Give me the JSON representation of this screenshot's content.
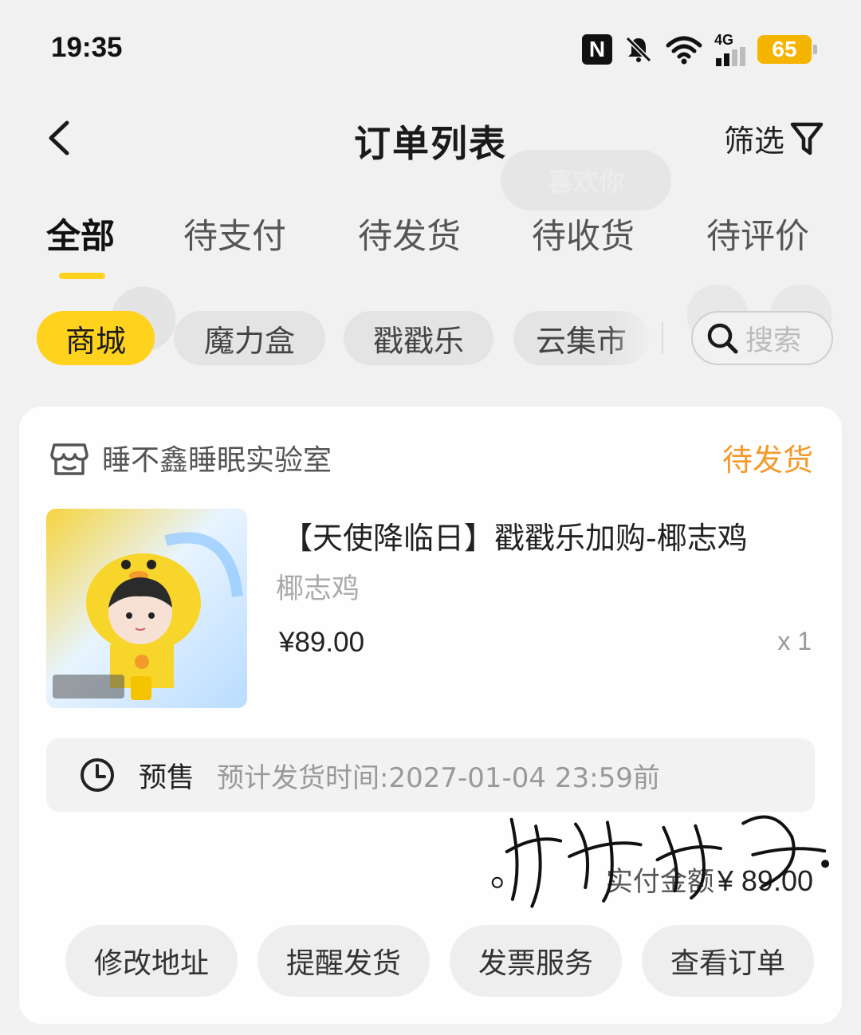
{
  "status_bar": {
    "time": "19:35",
    "network": "4G",
    "battery": "65",
    "icons": [
      "nfc-icon",
      "mute-icon",
      "wifi-icon",
      "signal-icon",
      "battery-icon"
    ]
  },
  "header": {
    "title": "订单列表",
    "filter_label": "筛选",
    "back_icon": "chevron-left-icon",
    "filter_icon": "funnel-icon"
  },
  "background_ghost": {
    "follow_label": "喜欢你"
  },
  "tabs": [
    {
      "label": "全部",
      "active": true
    },
    {
      "label": "待支付",
      "active": false
    },
    {
      "label": "待发货",
      "active": false
    },
    {
      "label": "待收货",
      "active": false
    },
    {
      "label": "待评价",
      "active": false
    }
  ],
  "chips": [
    {
      "label": "商城",
      "active": true
    },
    {
      "label": "魔力盒",
      "active": false
    },
    {
      "label": "戳戳乐",
      "active": false
    },
    {
      "label": "云集市",
      "active": false
    }
  ],
  "search": {
    "placeholder": "搜索",
    "icon": "search-icon"
  },
  "order": {
    "shop_name": "睡不鑫睡眠实验室",
    "status": "待发货",
    "product": {
      "title": "【天使降临日】戳戳乐加购-椰志鸡",
      "spec": "椰志鸡",
      "price": "¥89.00",
      "quantity": "x 1"
    },
    "presale": {
      "label": "预售",
      "text": "预计发货时间:2027-01-04 23:59前"
    },
    "total": {
      "label": "实付金额",
      "value": "¥ 89.00"
    },
    "actions": [
      "修改地址",
      "提醒发货",
      "发票服务",
      "查看订单"
    ]
  },
  "colors": {
    "accent_yellow": "#ffd21e",
    "status_orange": "#f39a2b",
    "battery": "#f5b400",
    "page_bg": "#f1f1f1"
  }
}
